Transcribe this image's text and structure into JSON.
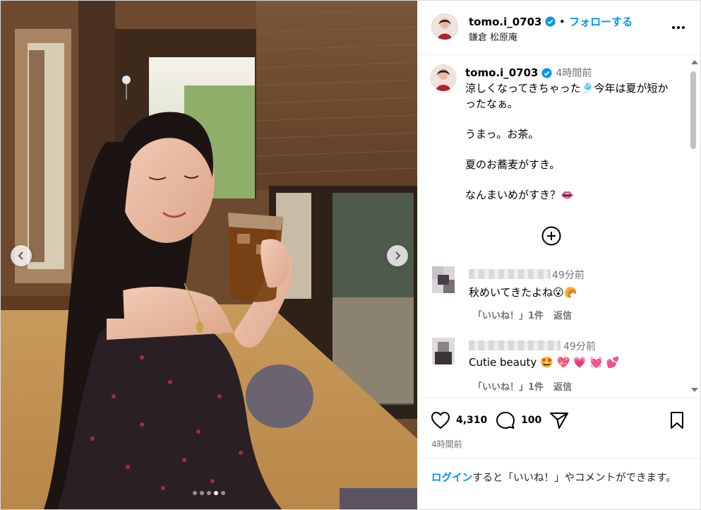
{
  "post": {
    "username": "tomo.i_0703",
    "follow_label": "フォローする",
    "separator": "•",
    "location": "鎌倉 松原庵",
    "caption_time": "4時間前",
    "caption": "涼しくなってきちゃった🎐今年は夏が短かったなぁ。\n\nうまっ。お茶。\n\n夏のお蕎麦がすき。\n\nなんまいめがすき？👄",
    "likes": "4,310",
    "comments_count": "100",
    "posted_time": "4時間前"
  },
  "media": {
    "slide_count": 5,
    "active_slide": 3
  },
  "comments": [
    {
      "time": "49分前",
      "text": "秋めいてきたよね😮🥐",
      "like_label": "「いいね！」1件",
      "reply_label": "返信"
    },
    {
      "time": "49分前",
      "text": "Cutie beauty 🤩 💖 💗 💓 💕",
      "like_label": "「いいね！」1件",
      "reply_label": "返信"
    }
  ],
  "login": {
    "link": "ログイン",
    "text": "すると「いいね！」やコメントができます。"
  },
  "colors": {
    "accent": "#0095f6",
    "secondary_text": "#737373",
    "border": "#efefef"
  },
  "icons": {
    "like": "heart-icon",
    "comment": "comment-icon",
    "share": "paper-plane-icon",
    "save": "bookmark-icon",
    "more": "more-options-icon",
    "load": "plus-circle-icon"
  }
}
